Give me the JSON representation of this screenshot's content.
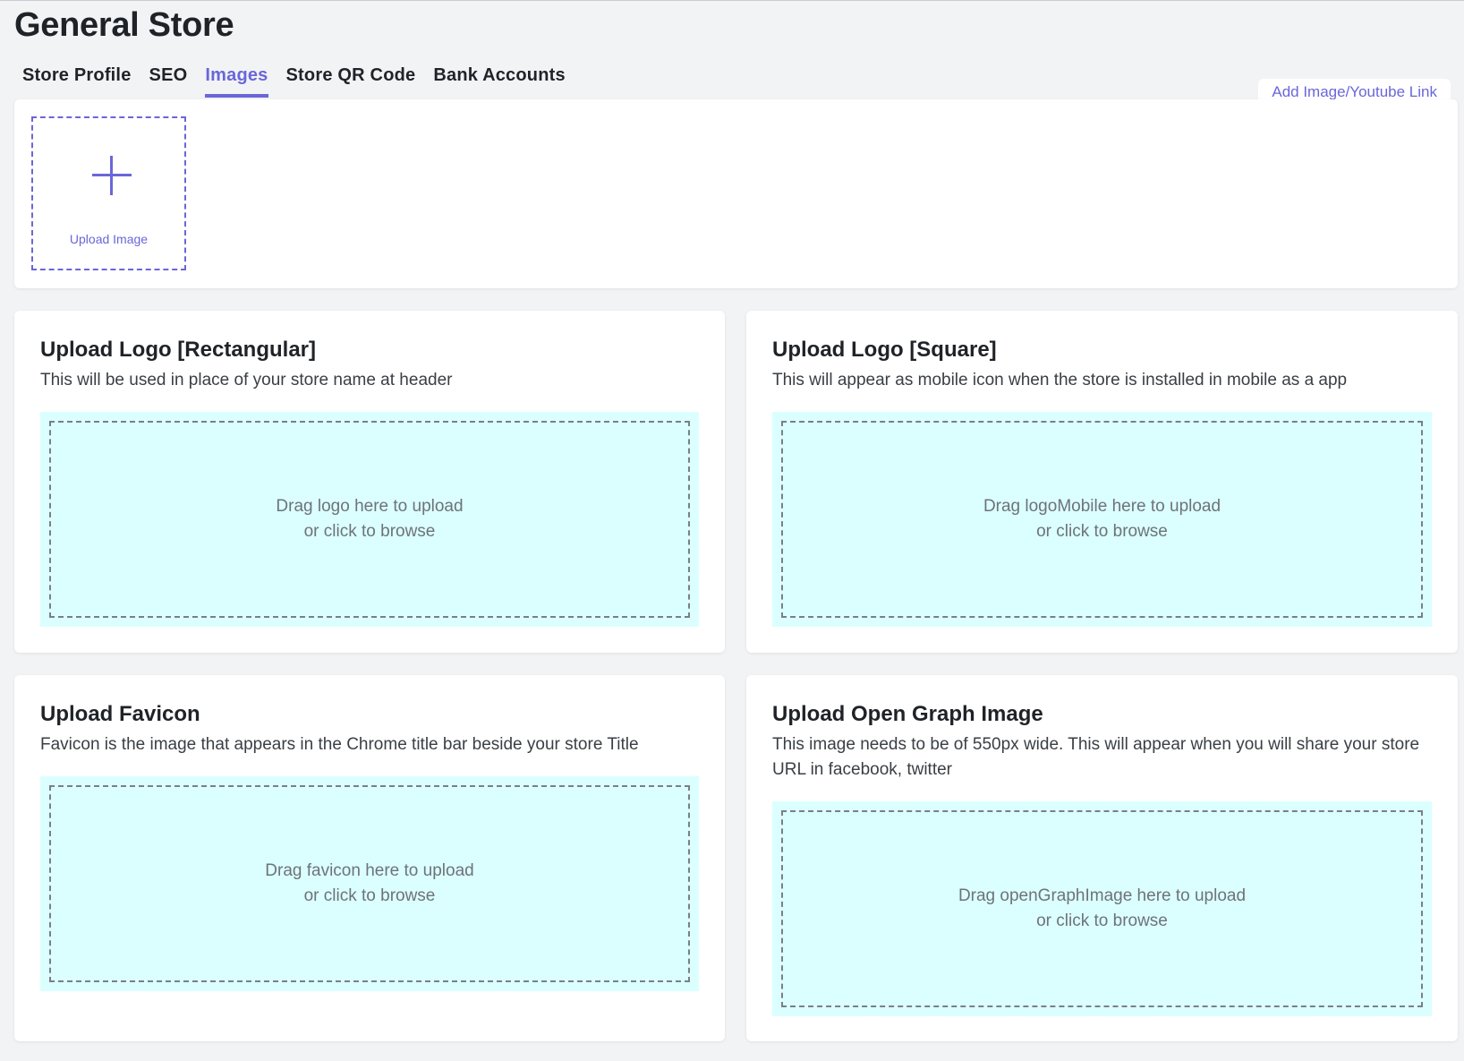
{
  "page": {
    "title": "General Store"
  },
  "tabs": [
    {
      "label": "Store Profile",
      "active": false
    },
    {
      "label": "SEO",
      "active": false
    },
    {
      "label": "Images",
      "active": true
    },
    {
      "label": "Store QR Code",
      "active": false
    },
    {
      "label": "Bank Accounts",
      "active": false
    }
  ],
  "gallery": {
    "add_link_label": "Add Image/Youtube Link",
    "upload_tile_label": "Upload Image",
    "upload_icon": "plus-icon"
  },
  "cards": {
    "logo_rect": {
      "title": "Upload Logo [Rectangular]",
      "description": "This will be used in place of your store name at header",
      "drop_line1": "Drag logo here to upload",
      "drop_line2": "or click to browse"
    },
    "logo_square": {
      "title": "Upload Logo [Square]",
      "description": "This will appear as mobile icon when the store is installed in mobile as a app",
      "drop_line1": "Drag logoMobile here to upload",
      "drop_line2": "or click to browse"
    },
    "favicon": {
      "title": "Upload Favicon",
      "description": "Favicon is the image that appears in the Chrome title bar beside your store Title",
      "drop_line1": "Drag favicon here to upload",
      "drop_line2": "or click to browse"
    },
    "open_graph": {
      "title": "Upload Open Graph Image",
      "description": "This image needs to be of 550px wide. This will appear when you will share your store URL in facebook, twitter",
      "drop_line1": "Drag openGraphImage here to upload",
      "drop_line2": "or click to browse"
    }
  },
  "colors": {
    "accent": "#6a66d9",
    "dropzone_bg": "#dbffff",
    "page_bg": "#f2f3f5"
  }
}
